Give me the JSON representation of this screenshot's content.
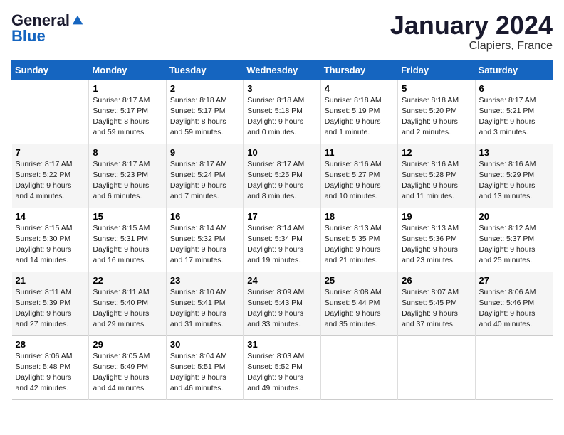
{
  "logo": {
    "general": "General",
    "blue": "Blue"
  },
  "title": "January 2024",
  "subtitle": "Clapiers, France",
  "days_header": [
    "Sunday",
    "Monday",
    "Tuesday",
    "Wednesday",
    "Thursday",
    "Friday",
    "Saturday"
  ],
  "weeks": [
    [
      {
        "day": "",
        "info": ""
      },
      {
        "day": "1",
        "info": "Sunrise: 8:17 AM\nSunset: 5:17 PM\nDaylight: 8 hours\nand 59 minutes."
      },
      {
        "day": "2",
        "info": "Sunrise: 8:18 AM\nSunset: 5:17 PM\nDaylight: 8 hours\nand 59 minutes."
      },
      {
        "day": "3",
        "info": "Sunrise: 8:18 AM\nSunset: 5:18 PM\nDaylight: 9 hours\nand 0 minutes."
      },
      {
        "day": "4",
        "info": "Sunrise: 8:18 AM\nSunset: 5:19 PM\nDaylight: 9 hours\nand 1 minute."
      },
      {
        "day": "5",
        "info": "Sunrise: 8:18 AM\nSunset: 5:20 PM\nDaylight: 9 hours\nand 2 minutes."
      },
      {
        "day": "6",
        "info": "Sunrise: 8:17 AM\nSunset: 5:21 PM\nDaylight: 9 hours\nand 3 minutes."
      }
    ],
    [
      {
        "day": "7",
        "info": "Sunrise: 8:17 AM\nSunset: 5:22 PM\nDaylight: 9 hours\nand 4 minutes."
      },
      {
        "day": "8",
        "info": "Sunrise: 8:17 AM\nSunset: 5:23 PM\nDaylight: 9 hours\nand 6 minutes."
      },
      {
        "day": "9",
        "info": "Sunrise: 8:17 AM\nSunset: 5:24 PM\nDaylight: 9 hours\nand 7 minutes."
      },
      {
        "day": "10",
        "info": "Sunrise: 8:17 AM\nSunset: 5:25 PM\nDaylight: 9 hours\nand 8 minutes."
      },
      {
        "day": "11",
        "info": "Sunrise: 8:16 AM\nSunset: 5:27 PM\nDaylight: 9 hours\nand 10 minutes."
      },
      {
        "day": "12",
        "info": "Sunrise: 8:16 AM\nSunset: 5:28 PM\nDaylight: 9 hours\nand 11 minutes."
      },
      {
        "day": "13",
        "info": "Sunrise: 8:16 AM\nSunset: 5:29 PM\nDaylight: 9 hours\nand 13 minutes."
      }
    ],
    [
      {
        "day": "14",
        "info": "Sunrise: 8:15 AM\nSunset: 5:30 PM\nDaylight: 9 hours\nand 14 minutes."
      },
      {
        "day": "15",
        "info": "Sunrise: 8:15 AM\nSunset: 5:31 PM\nDaylight: 9 hours\nand 16 minutes."
      },
      {
        "day": "16",
        "info": "Sunrise: 8:14 AM\nSunset: 5:32 PM\nDaylight: 9 hours\nand 17 minutes."
      },
      {
        "day": "17",
        "info": "Sunrise: 8:14 AM\nSunset: 5:34 PM\nDaylight: 9 hours\nand 19 minutes."
      },
      {
        "day": "18",
        "info": "Sunrise: 8:13 AM\nSunset: 5:35 PM\nDaylight: 9 hours\nand 21 minutes."
      },
      {
        "day": "19",
        "info": "Sunrise: 8:13 AM\nSunset: 5:36 PM\nDaylight: 9 hours\nand 23 minutes."
      },
      {
        "day": "20",
        "info": "Sunrise: 8:12 AM\nSunset: 5:37 PM\nDaylight: 9 hours\nand 25 minutes."
      }
    ],
    [
      {
        "day": "21",
        "info": "Sunrise: 8:11 AM\nSunset: 5:39 PM\nDaylight: 9 hours\nand 27 minutes."
      },
      {
        "day": "22",
        "info": "Sunrise: 8:11 AM\nSunset: 5:40 PM\nDaylight: 9 hours\nand 29 minutes."
      },
      {
        "day": "23",
        "info": "Sunrise: 8:10 AM\nSunset: 5:41 PM\nDaylight: 9 hours\nand 31 minutes."
      },
      {
        "day": "24",
        "info": "Sunrise: 8:09 AM\nSunset: 5:43 PM\nDaylight: 9 hours\nand 33 minutes."
      },
      {
        "day": "25",
        "info": "Sunrise: 8:08 AM\nSunset: 5:44 PM\nDaylight: 9 hours\nand 35 minutes."
      },
      {
        "day": "26",
        "info": "Sunrise: 8:07 AM\nSunset: 5:45 PM\nDaylight: 9 hours\nand 37 minutes."
      },
      {
        "day": "27",
        "info": "Sunrise: 8:06 AM\nSunset: 5:46 PM\nDaylight: 9 hours\nand 40 minutes."
      }
    ],
    [
      {
        "day": "28",
        "info": "Sunrise: 8:06 AM\nSunset: 5:48 PM\nDaylight: 9 hours\nand 42 minutes."
      },
      {
        "day": "29",
        "info": "Sunrise: 8:05 AM\nSunset: 5:49 PM\nDaylight: 9 hours\nand 44 minutes."
      },
      {
        "day": "30",
        "info": "Sunrise: 8:04 AM\nSunset: 5:51 PM\nDaylight: 9 hours\nand 46 minutes."
      },
      {
        "day": "31",
        "info": "Sunrise: 8:03 AM\nSunset: 5:52 PM\nDaylight: 9 hours\nand 49 minutes."
      },
      {
        "day": "",
        "info": ""
      },
      {
        "day": "",
        "info": ""
      },
      {
        "day": "",
        "info": ""
      }
    ]
  ]
}
